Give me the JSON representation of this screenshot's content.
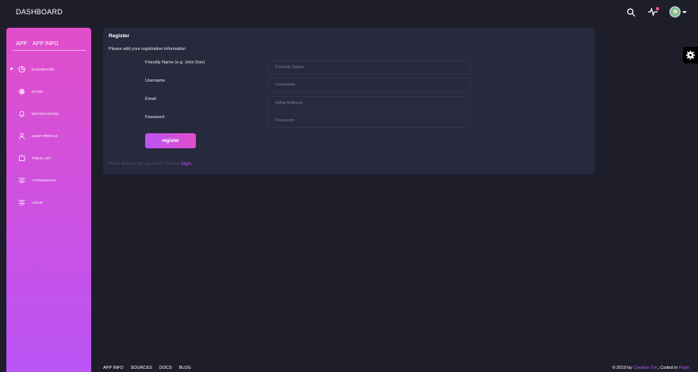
{
  "navbar": {
    "brand": "DASHBOARD",
    "icons": [
      "search-icon",
      "activity-icon",
      "avatar"
    ]
  },
  "sidebar": {
    "logo_mini": "APP",
    "logo_normal": "APP INFO",
    "items": [
      {
        "label": "DASHBOARD",
        "icon": "chart-pie-icon",
        "active": true
      },
      {
        "label": "ICONS",
        "icon": "atom-icon"
      },
      {
        "label": "NOTIFICATIONS",
        "icon": "bell-icon"
      },
      {
        "label": "USER PROFILE",
        "icon": "user-icon"
      },
      {
        "label": "TABLE LIST",
        "icon": "puzzle-icon"
      },
      {
        "label": "TYPOGRAPHY",
        "icon": "align-center-icon"
      },
      {
        "label": "LOGIN",
        "icon": "align-center-icon"
      }
    ]
  },
  "card": {
    "title": "Register",
    "subtitle": "Please add your registration information",
    "fields": [
      {
        "label": "Friendly Name (e.g. John Doe)",
        "placeholder": "Friendly Name"
      },
      {
        "label": "Username",
        "placeholder": "Username"
      },
      {
        "label": "Email",
        "placeholder": "eMail Address"
      },
      {
        "label": "Password",
        "placeholder": "Password"
      }
    ],
    "submit_label": "register",
    "login_prompt": "Have already an account? Please ",
    "login_link": "login"
  },
  "footer": {
    "links": [
      "APP INFO",
      "SOURCES",
      "DOCS",
      "BLOG"
    ],
    "copyright_prefix": "© 2019 by ",
    "author": "Creative Tim",
    "coded_prefix": ", Coded in ",
    "coded_by": "Flask"
  },
  "colors": {
    "background": "#1e1e2b",
    "card": "#27293d",
    "accent_start": "#e14eca",
    "accent_end": "#ba54f5"
  }
}
